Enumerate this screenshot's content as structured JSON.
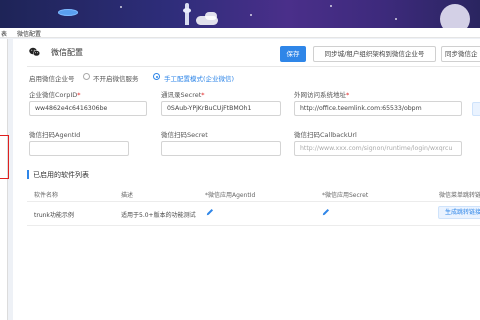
{
  "topnav": {
    "item1": "表",
    "item2": "微信配置"
  },
  "header": {
    "title": "微信配置",
    "save_label": "保存",
    "sync_org_label": "同步城/租户组织架构到微信企业号",
    "sync_wechat_label": "同步微信企"
  },
  "mode": {
    "prefix": "启用微信企业号",
    "option_off": "不开启微信服务",
    "option_manual": "手工配置模式(企业微信)",
    "selected": "option_manual"
  },
  "fields": {
    "corpid": {
      "label": "企业微信CorpID",
      "value": "ww4862e4c6416306be"
    },
    "secret": {
      "label": "通讯录Secret",
      "value": "0SAub-YPjKrBuCUjFtBMOh1"
    },
    "external_url": {
      "label": "外网访问系统地址",
      "value": "http://office.teemlink.com:65533/obpm"
    },
    "agentid": {
      "label": "微信扫码AgentId",
      "value": ""
    },
    "scan_secret": {
      "label": "微信扫码Secret",
      "value": ""
    },
    "callback": {
      "label": "微信扫码CallbackUrl",
      "value": "",
      "placeholder": "http://www.xxx.com/signon/runtime/login/wxqrcu"
    }
  },
  "software": {
    "section_title": "已启用的软件列表",
    "columns": [
      "软件名称",
      "描述",
      "*微信应用AgentId",
      "*微信应用Secret",
      "微信菜单跳转链"
    ],
    "rows": [
      {
        "name": "trunk功能示例",
        "desc": "适用于5.0+版本的功能测试",
        "action": "生成跳转链接"
      }
    ]
  },
  "icons": {
    "header": "wechat-icon",
    "edit": "pencil-icon"
  },
  "colors": {
    "accent": "#2f86e8",
    "required": "#e02020",
    "banner": "#2e2d7a"
  }
}
